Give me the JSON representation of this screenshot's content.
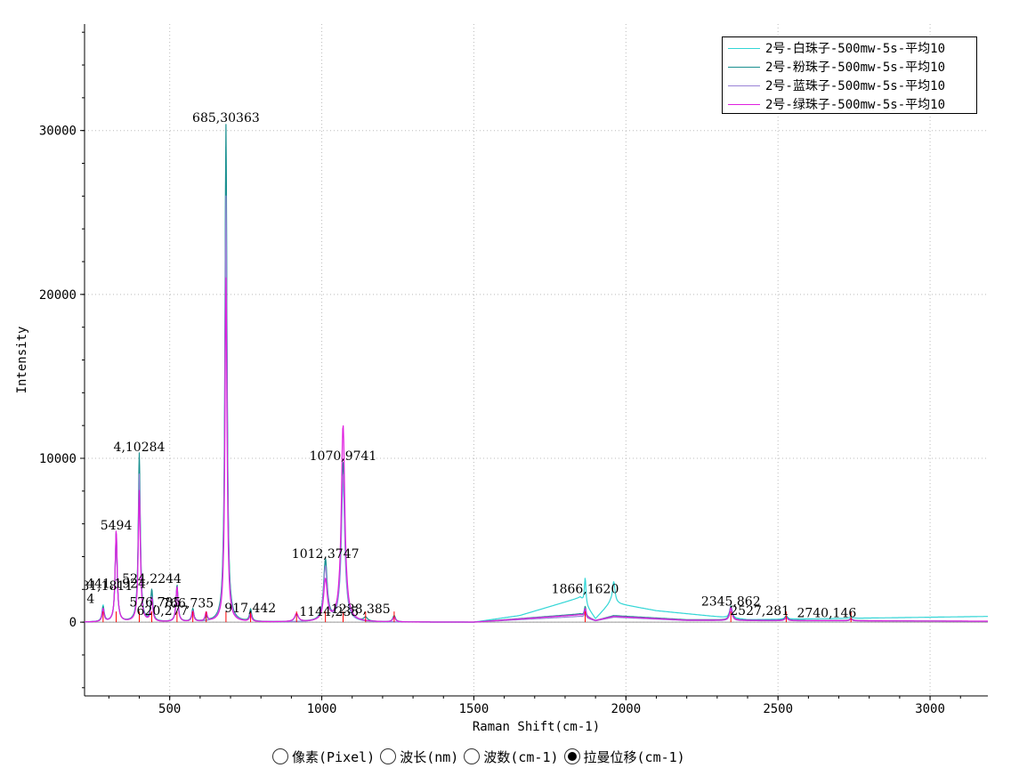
{
  "chart_data": {
    "type": "line",
    "xlabel": "Raman Shift(cm-1)",
    "ylabel": "Intensity",
    "xlim": [
      220,
      3190
    ],
    "ylim": [
      -4500,
      36500
    ],
    "x_ticks": [
      500,
      1000,
      1500,
      2000,
      2500,
      3000
    ],
    "y_ticks": [
      0,
      10000,
      20000,
      30000
    ],
    "grid": true,
    "legend_position": "top-right",
    "series": [
      {
        "name": "2号-白珠子-500mw-5s-平均10",
        "color": "#33d6d6",
        "peaks": [
          [
            281,
            1000
          ],
          [
            324,
            5400
          ],
          [
            400,
            9600
          ],
          [
            441,
            1800
          ],
          [
            524,
            2100
          ],
          [
            576,
            700
          ],
          [
            685,
            29000
          ],
          [
            766,
            500
          ],
          [
            1012,
            3600
          ],
          [
            1070,
            8500
          ],
          [
            1866,
            1620
          ],
          [
            1960,
            1300
          ],
          [
            2345,
            700
          ],
          [
            2527,
            200
          ],
          [
            2740,
            120
          ]
        ],
        "baseline": [
          [
            1500,
            0
          ],
          [
            1650,
            400
          ],
          [
            1850,
            1500
          ],
          [
            1900,
            200
          ],
          [
            1950,
            1200
          ],
          [
            2100,
            700
          ],
          [
            2400,
            150
          ],
          [
            3190,
            350
          ]
        ]
      },
      {
        "name": "2号-粉珠子-500mw-5s-平均10",
        "color": "#1a8f8f",
        "peaks": [
          [
            281,
            900
          ],
          [
            324,
            5494
          ],
          [
            400,
            10284
          ],
          [
            441,
            1924
          ],
          [
            524,
            2244
          ],
          [
            576,
            785
          ],
          [
            620,
            277
          ],
          [
            685,
            30363
          ],
          [
            766,
            735
          ],
          [
            917,
            442
          ],
          [
            1012,
            3747
          ],
          [
            1070,
            9741
          ],
          [
            1144,
            235
          ],
          [
            1238,
            385
          ],
          [
            1866,
            600
          ],
          [
            2345,
            862
          ],
          [
            2527,
            281
          ],
          [
            2740,
            146
          ]
        ],
        "baseline": [
          [
            1500,
            0
          ],
          [
            1850,
            500
          ],
          [
            1900,
            100
          ],
          [
            1960,
            400
          ],
          [
            2200,
            150
          ],
          [
            3190,
            50
          ]
        ]
      },
      {
        "name": "2号-蓝珠子-500mw-5s-平均10",
        "color": "#9a82d6",
        "peaks": [
          [
            281,
            700
          ],
          [
            324,
            5200
          ],
          [
            400,
            9000
          ],
          [
            441,
            1500
          ],
          [
            524,
            2000
          ],
          [
            576,
            600
          ],
          [
            685,
            26000
          ],
          [
            766,
            500
          ],
          [
            1012,
            3300
          ],
          [
            1070,
            9000
          ],
          [
            1866,
            400
          ],
          [
            2345,
            700
          ],
          [
            2527,
            200
          ],
          [
            2740,
            120
          ]
        ],
        "baseline": [
          [
            1500,
            0
          ],
          [
            1850,
            350
          ],
          [
            1900,
            80
          ],
          [
            1960,
            300
          ],
          [
            2200,
            100
          ],
          [
            3190,
            50
          ]
        ]
      },
      {
        "name": "2号-绿珠子-500mw-5s-平均10",
        "color": "#e020e0",
        "peaks": [
          [
            281,
            800
          ],
          [
            324,
            5600
          ],
          [
            400,
            8000
          ],
          [
            441,
            1400
          ],
          [
            524,
            2150
          ],
          [
            576,
            650
          ],
          [
            620,
            550
          ],
          [
            685,
            21000
          ],
          [
            766,
            450
          ],
          [
            917,
            500
          ],
          [
            1012,
            2500
          ],
          [
            1070,
            12000
          ],
          [
            1238,
            300
          ],
          [
            1866,
            500
          ],
          [
            2345,
            800
          ],
          [
            2527,
            200
          ],
          [
            2740,
            100
          ]
        ],
        "baseline": [
          [
            1500,
            0
          ],
          [
            1850,
            450
          ],
          [
            1900,
            100
          ],
          [
            1960,
            350
          ],
          [
            2200,
            120
          ],
          [
            3190,
            60
          ]
        ]
      }
    ],
    "peak_markers": [
      281,
      324,
      400,
      441,
      524,
      576,
      620,
      685,
      766,
      917,
      1012,
      1070,
      1144,
      1238,
      1866,
      2345,
      2527,
      2740
    ],
    "annotations": [
      {
        "text": "4,10284",
        "x": 400,
        "y": 10284
      },
      {
        "text": "5494",
        "x": 324,
        "y": 5494
      },
      {
        "text": "524,2244",
        "x": 441,
        "y": 2244
      },
      {
        "text": "441,1924",
        "x": 324,
        "y": 1924
      },
      {
        "text": "281,1811",
        "x": 281,
        "y": 1811
      },
      {
        "text": "4",
        "x": 240,
        "y": 1000
      },
      {
        "text": "576,785",
        "x": 452,
        "y": 785
      },
      {
        "text": "620,277",
        "x": 476,
        "y": 277
      },
      {
        "text": "766,735",
        "x": 560,
        "y": 735
      },
      {
        "text": "685,30363",
        "x": 685,
        "y": 30363
      },
      {
        "text": "917,442",
        "x": 765,
        "y": 442
      },
      {
        "text": "1012,3747",
        "x": 1012,
        "y": 3747
      },
      {
        "text": "1070,9741",
        "x": 1070,
        "y": 9741
      },
      {
        "text": "1144,235",
        "x": 1024,
        "y": 235
      },
      {
        "text": "1238,385",
        "x": 1128,
        "y": 385
      },
      {
        "text": "1866,1620",
        "x": 1866,
        "y": 1620
      },
      {
        "text": "2345,862",
        "x": 2345,
        "y": 862
      },
      {
        "text": "2527,281",
        "x": 2440,
        "y": 281
      },
      {
        "text": "2740,146",
        "x": 2660,
        "y": 146
      }
    ]
  },
  "legend": {
    "items": [
      {
        "label": "2号-白珠子-500mw-5s-平均10",
        "color": "#33d6d6"
      },
      {
        "label": "2号-粉珠子-500mw-5s-平均10",
        "color": "#1a8f8f"
      },
      {
        "label": "2号-蓝珠子-500mw-5s-平均10",
        "color": "#9a82d6"
      },
      {
        "label": "2号-绿珠子-500mw-5s-平均10",
        "color": "#e020e0"
      }
    ]
  },
  "unit_selector": {
    "options": [
      {
        "label": "像素(Pixel)",
        "selected": false
      },
      {
        "label": "波长(nm)",
        "selected": false
      },
      {
        "label": "波数(cm-1)",
        "selected": false
      },
      {
        "label": "拉曼位移(cm-1)",
        "selected": true
      }
    ]
  },
  "colors": {
    "marker": "#ff0000",
    "grid": "#bbbbbb",
    "axis": "#000000"
  }
}
